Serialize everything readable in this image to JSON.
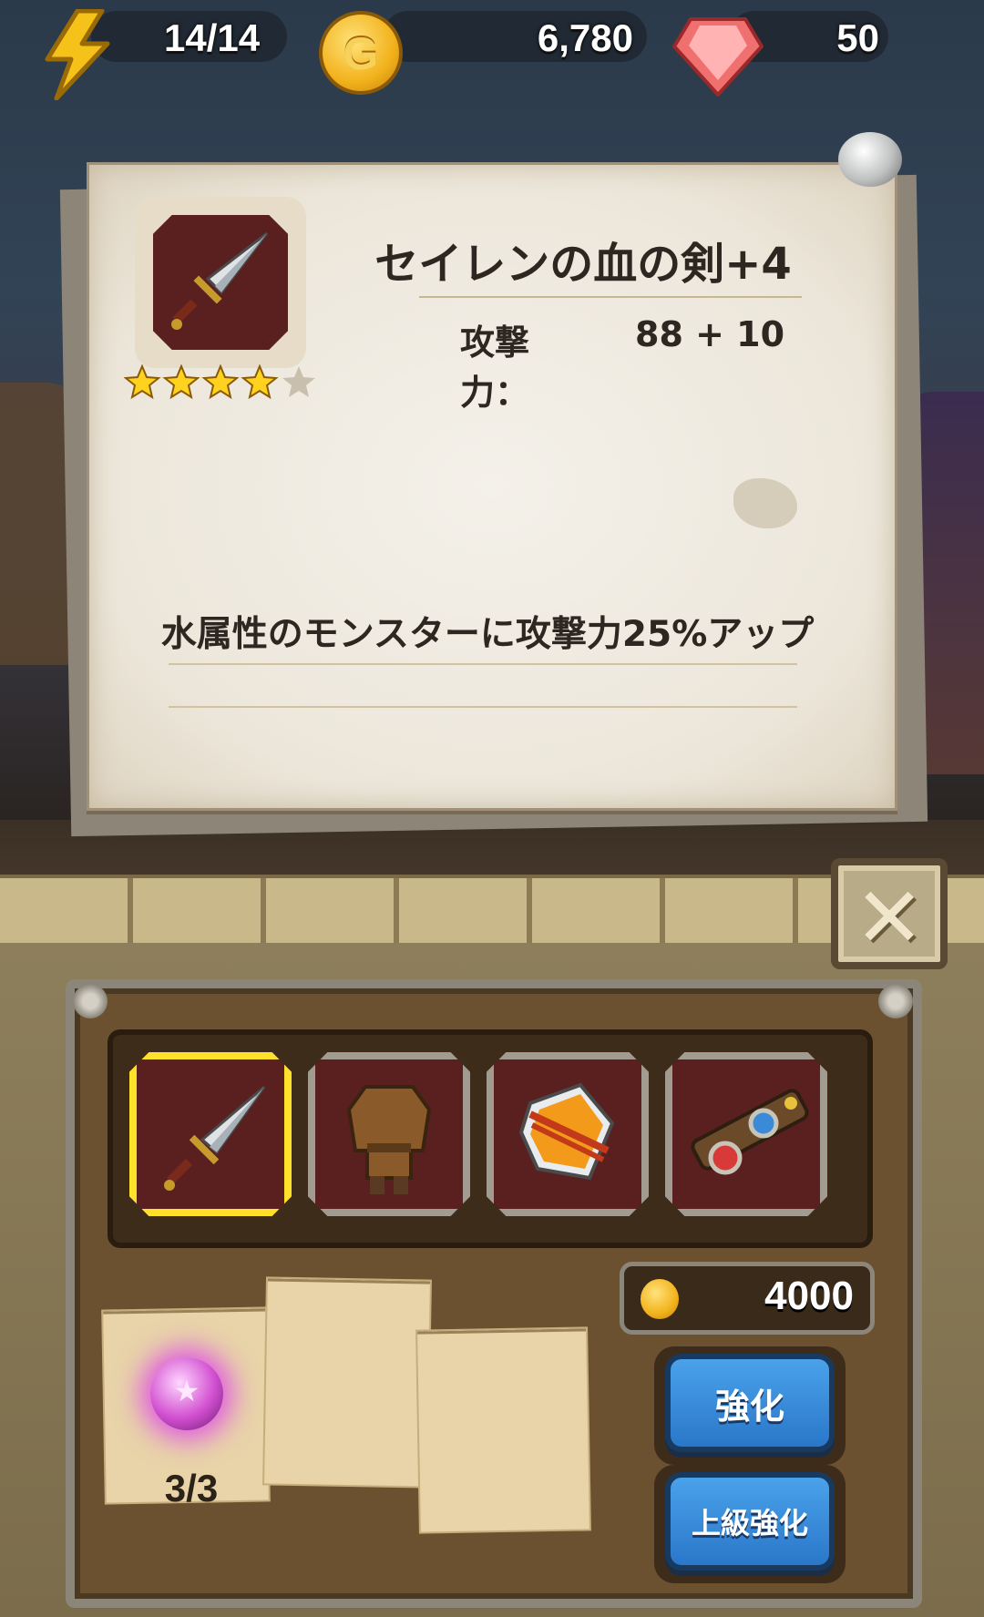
{
  "resources": {
    "energy": "14/14",
    "gold": "6,780",
    "gems": "50"
  },
  "item": {
    "name": "セイレンの血の剣+4",
    "stat_label": "攻撃力：",
    "stat_value": "88 + 10",
    "effect": "水属性のモンスターに攻撃力25%アップ",
    "stars": 4,
    "max_stars": 5
  },
  "equipment_slots": [
    "sword",
    "tunic",
    "shield",
    "belt"
  ],
  "selected_slot": "sword",
  "upgrade": {
    "cost": "4000",
    "material_count": "3/3",
    "button_enhance": "強化",
    "button_advanced": "上級強化"
  },
  "colors": {
    "selected_border": "#ffe02a",
    "button_blue": "#2a77c9",
    "parchment": "#ece6da"
  }
}
